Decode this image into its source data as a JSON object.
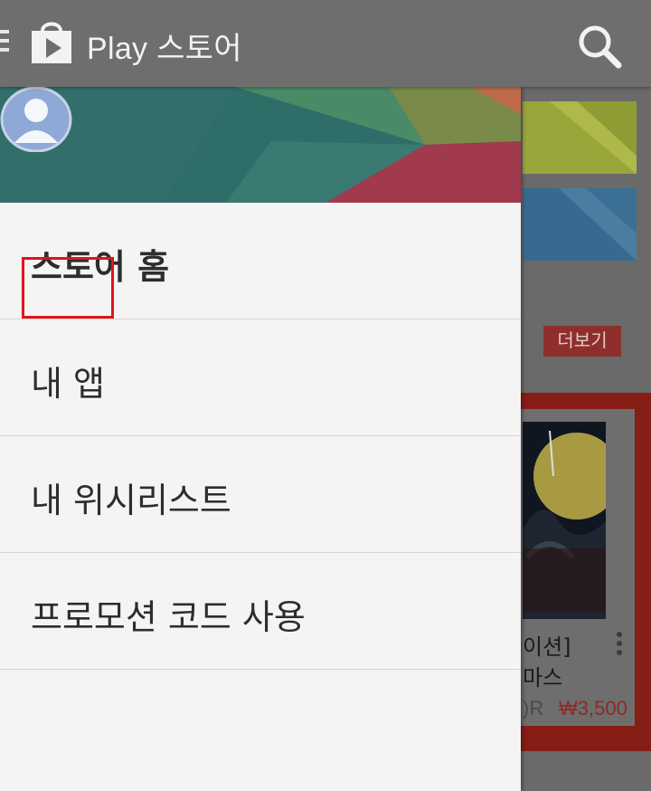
{
  "app": {
    "title": "Play 스토어"
  },
  "drawer": {
    "items": [
      {
        "label": "스토어 홈"
      },
      {
        "label": "내 앱"
      },
      {
        "label": "내 위시리스트"
      },
      {
        "label": "프로모션 코드 사용"
      }
    ]
  },
  "background": {
    "more_label": "더보기",
    "card": {
      "title": "이션]\n마스",
      "original_price_fragment": ")R",
      "price": "₩3,500"
    }
  },
  "colors": {
    "topbar": "#6e6e6e",
    "drawer": "#f4f4f4",
    "highlight": "#e0141a",
    "accent_red": "#861e15"
  },
  "icons": [
    "menu-icon",
    "play-store-bag-icon",
    "search-icon",
    "avatar-icon",
    "overflow-menu-icon"
  ]
}
